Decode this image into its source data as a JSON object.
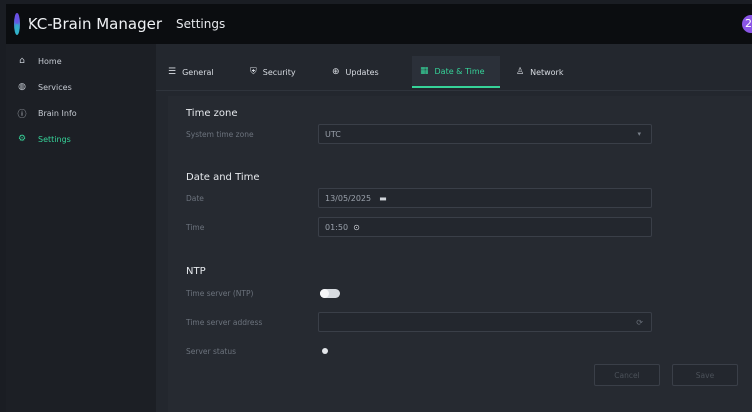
{
  "app": {
    "title": "KC-Brain Manager",
    "page_title": "Settings",
    "avatar_glyph": "2"
  },
  "sidebar": {
    "items": [
      {
        "label": "Home",
        "icon": "home-icon",
        "glyph": "⌂"
      },
      {
        "label": "Services",
        "icon": "services-icon",
        "glyph": "◍"
      },
      {
        "label": "Brain Info",
        "icon": "info-icon",
        "glyph": "ⓘ"
      },
      {
        "label": "Settings",
        "icon": "gear-icon",
        "glyph": "⚙"
      }
    ],
    "active_index": 3
  },
  "tabs": [
    {
      "label": "General",
      "icon": "list-icon",
      "glyph": "☰"
    },
    {
      "label": "Security",
      "icon": "shield-icon",
      "glyph": "⛨"
    },
    {
      "label": "Updates",
      "icon": "update-icon",
      "glyph": "⊕"
    },
    {
      "label": "Date & Time",
      "icon": "calendar-icon",
      "glyph": "▦"
    },
    {
      "label": "Network",
      "icon": "network-icon",
      "glyph": "♙"
    }
  ],
  "active_tab": "Date & Time",
  "timezone": {
    "section_title": "Time zone",
    "label": "System time zone",
    "value": "UTC"
  },
  "datetime": {
    "section_title": "Date and Time",
    "date_label": "Date",
    "date_value": "13/05/2025",
    "time_label": "Time",
    "time_value": "01:50"
  },
  "ntp": {
    "section_title": "NTP",
    "server_toggle_label": "Time server (NTP)",
    "server_enabled": false,
    "address_label": "Time server address",
    "address_value": "",
    "status_label": "Server status"
  },
  "buttons": {
    "cancel": "Cancel",
    "save": "Save"
  },
  "colors": {
    "accent": "#36d399",
    "background": "#23272e",
    "topbar": "#0b0d10"
  }
}
